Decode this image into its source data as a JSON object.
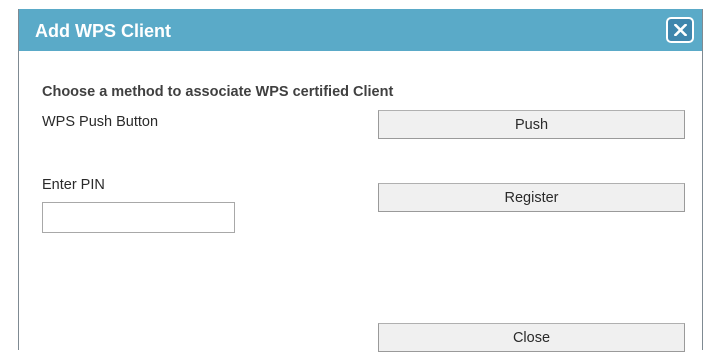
{
  "dialog": {
    "title": "Add WPS Client",
    "close_icon_glyph": "X",
    "close_icon_name": "close-icon",
    "title_bar_color": "#5aaac8",
    "close_button_color": "#3f86ad"
  },
  "content": {
    "heading": "Choose a method to associate WPS certified Client",
    "push_label": "WPS Push Button",
    "push_button": "Push",
    "pin_label": "Enter PIN",
    "pin_value": "",
    "pin_placeholder": "",
    "register_button": "Register"
  },
  "footer": {
    "close_button": "Close"
  }
}
